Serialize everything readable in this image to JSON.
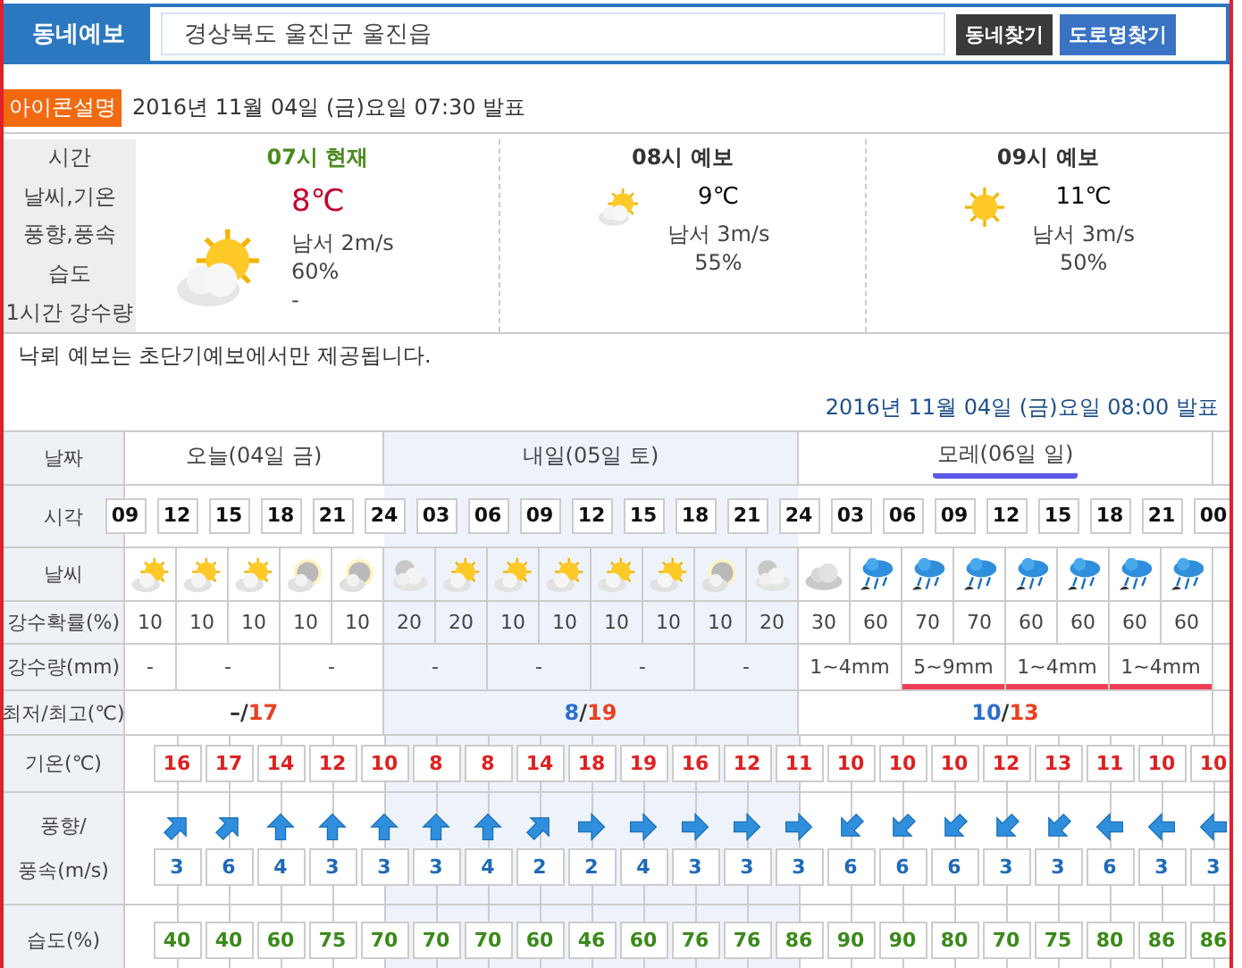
{
  "header": {
    "title": "동네예보",
    "address": "경상북도 울진군 울진읍",
    "buttons": [
      {
        "label": "동네찾기",
        "kind": "dark"
      },
      {
        "label": "도로명찾기",
        "kind": "blue"
      }
    ]
  },
  "now": {
    "badge": "아이콘설명",
    "issued": "2016년 11월 04일 (금)요일 07:30 발표",
    "labels": [
      "시간",
      "날씨,기온",
      "풍향,풍속",
      "습도",
      "1시간 강수량"
    ],
    "columns": [
      {
        "title": "07시 현재",
        "current": true,
        "kind": "partly_day",
        "temp": "8℃",
        "wind": "남서 2m/s",
        "humidity": "60%",
        "rain": "-"
      },
      {
        "title": "08시 예보",
        "current": false,
        "kind": "partly_day",
        "temp": "9℃",
        "wind": "남서 3m/s",
        "humidity": "55%"
      },
      {
        "title": "09시 예보",
        "current": false,
        "kind": "sunny",
        "temp": "11℃",
        "wind": "남서 3m/s",
        "humidity": "50%"
      }
    ],
    "note": "낙뢰 예보는 초단기예보에서만 제공됩니다."
  },
  "forecast": {
    "issued": "2016년 11월 04일 (금)요일 08:00 발표",
    "labels": {
      "date": "날짜",
      "time": "시각",
      "weather": "날씨",
      "rain_prob": "강수확률(%)",
      "rain_amount": "강수량(mm)",
      "minmax": "최저/최고(℃)",
      "temp": "기온(℃)",
      "wind_a": "풍향/",
      "wind_b": "풍속(m/s)",
      "humidity": "습도(%)"
    },
    "days": [
      {
        "label": "오늘(04일 금)",
        "shaded": false,
        "highlighted": false,
        "low": "–",
        "slash": "/",
        "high": "17",
        "columns": [
          {
            "kind": "partly_day",
            "rain_prob": "10"
          },
          {
            "kind": "partly_day",
            "rain_prob": "10"
          },
          {
            "kind": "partly_day",
            "rain_prob": "10"
          },
          {
            "kind": "partly_night",
            "rain_prob": "10"
          },
          {
            "kind": "partly_night",
            "rain_prob": "10"
          }
        ]
      },
      {
        "label": "내일(05일 토)",
        "shaded": true,
        "highlighted": false,
        "low": "8",
        "slash": "/",
        "high": "19",
        "columns": [
          {
            "kind": "cloudy_night",
            "rain_prob": "20"
          },
          {
            "kind": "partly_day",
            "rain_prob": "20"
          },
          {
            "kind": "partly_day",
            "rain_prob": "10"
          },
          {
            "kind": "partly_day",
            "rain_prob": "10"
          },
          {
            "kind": "partly_day",
            "rain_prob": "10"
          },
          {
            "kind": "partly_day",
            "rain_prob": "10"
          },
          {
            "kind": "partly_night",
            "rain_prob": "10"
          },
          {
            "kind": "cloudy_night",
            "rain_prob": "20"
          }
        ]
      },
      {
        "label": "모레(06일 일)",
        "shaded": false,
        "highlighted": true,
        "low": "10",
        "slash": "/",
        "high": "13",
        "columns": [
          {
            "kind": "cloudy",
            "rain_prob": "30"
          },
          {
            "kind": "rain",
            "rain_prob": "60"
          },
          {
            "kind": "rain",
            "rain_prob": "70"
          },
          {
            "kind": "rain",
            "rain_prob": "70"
          },
          {
            "kind": "rain",
            "rain_prob": "60"
          },
          {
            "kind": "rain",
            "rain_prob": "60"
          },
          {
            "kind": "rain",
            "rain_prob": "60"
          },
          {
            "kind": "rain",
            "rain_prob": "60"
          }
        ]
      }
    ],
    "times": [
      "09",
      "12",
      "15",
      "18",
      "21",
      "24",
      "03",
      "06",
      "09",
      "12",
      "15",
      "18",
      "21",
      "24",
      "03",
      "06",
      "09",
      "12",
      "15",
      "18",
      "21",
      "00"
    ],
    "rain_amounts": [
      {
        "text": "-",
        "kind": "single",
        "highlighted": false
      },
      {
        "text": "-",
        "kind": "pair",
        "highlighted": false
      },
      {
        "text": "-",
        "kind": "pair",
        "highlighted": false
      },
      {
        "text": "-",
        "kind": "pair",
        "highlighted": false
      },
      {
        "text": "-",
        "kind": "pair",
        "highlighted": false
      },
      {
        "text": "-",
        "kind": "pair",
        "highlighted": false
      },
      {
        "text": "-",
        "kind": "pair",
        "highlighted": false
      },
      {
        "text": "1~4mm",
        "kind": "pair",
        "highlighted": false
      },
      {
        "text": "5~9mm",
        "kind": "pair",
        "highlighted": true
      },
      {
        "text": "1~4mm",
        "kind": "pair",
        "highlighted": true
      },
      {
        "text": "1~4mm",
        "kind": "pair",
        "highlighted": true
      }
    ],
    "temps": [
      "16",
      "17",
      "14",
      "12",
      "10",
      "8",
      "8",
      "14",
      "18",
      "19",
      "16",
      "12",
      "11",
      "10",
      "10",
      "10",
      "12",
      "13",
      "11",
      "10",
      "10"
    ],
    "wind": [
      {
        "kind": "ne",
        "speed": "3"
      },
      {
        "kind": "ne",
        "speed": "6"
      },
      {
        "kind": "n",
        "speed": "4"
      },
      {
        "kind": "n",
        "speed": "3"
      },
      {
        "kind": "n",
        "speed": "3"
      },
      {
        "kind": "n",
        "speed": "3"
      },
      {
        "kind": "n",
        "speed": "4"
      },
      {
        "kind": "ne",
        "speed": "2"
      },
      {
        "kind": "e",
        "speed": "2"
      },
      {
        "kind": "e",
        "speed": "4"
      },
      {
        "kind": "e",
        "speed": "3"
      },
      {
        "kind": "e",
        "speed": "3"
      },
      {
        "kind": "e",
        "speed": "3"
      },
      {
        "kind": "sw",
        "speed": "6"
      },
      {
        "kind": "sw",
        "speed": "6"
      },
      {
        "kind": "sw",
        "speed": "6"
      },
      {
        "kind": "sw",
        "speed": "3"
      },
      {
        "kind": "sw",
        "speed": "3"
      },
      {
        "kind": "w",
        "speed": "6"
      },
      {
        "kind": "w",
        "speed": "3"
      },
      {
        "kind": "w",
        "speed": "3"
      }
    ],
    "humidity": [
      "40",
      "40",
      "60",
      "75",
      "70",
      "70",
      "70",
      "60",
      "46",
      "60",
      "76",
      "76",
      "86",
      "90",
      "90",
      "80",
      "70",
      "75",
      "80",
      "86",
      "86"
    ]
  }
}
